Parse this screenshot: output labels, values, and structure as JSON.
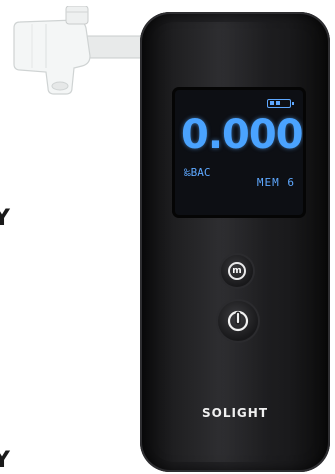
{
  "side_text": {
    "upper": "Y",
    "lower": "Y"
  },
  "device": {
    "display": {
      "reading": "0.000",
      "unit": "‰BAC",
      "memory_label": "MEM 6",
      "battery_icon": "battery-icon"
    },
    "buttons": {
      "menu_letter": "m",
      "power_icon": "power-icon"
    },
    "brand": "SOLIGHT"
  },
  "colors": {
    "lcd_text": "#4aa3ff",
    "body": "#1b1b1d",
    "mouthpiece": "#f2f4f4"
  }
}
